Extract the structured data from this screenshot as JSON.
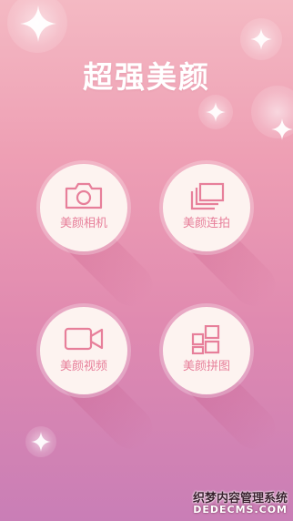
{
  "app": {
    "title": "超强美颜"
  },
  "menu": {
    "items": [
      {
        "label": "美颜相机",
        "icon": "camera-icon"
      },
      {
        "label": "美颜连拍",
        "icon": "burst-photos-icon"
      },
      {
        "label": "美颜视频",
        "icon": "video-camera-icon"
      },
      {
        "label": "美颜拼图",
        "icon": "collage-grid-icon"
      }
    ]
  },
  "watermark": {
    "main": "织梦内容管理系统",
    "url": "DEDECMS.COM"
  },
  "colors": {
    "bg_top": "#f4b9c3",
    "bg_bottom": "#c97eb6",
    "button_face": "#fdf3f0",
    "accent": "#e77f9a",
    "title": "#ffffff"
  }
}
